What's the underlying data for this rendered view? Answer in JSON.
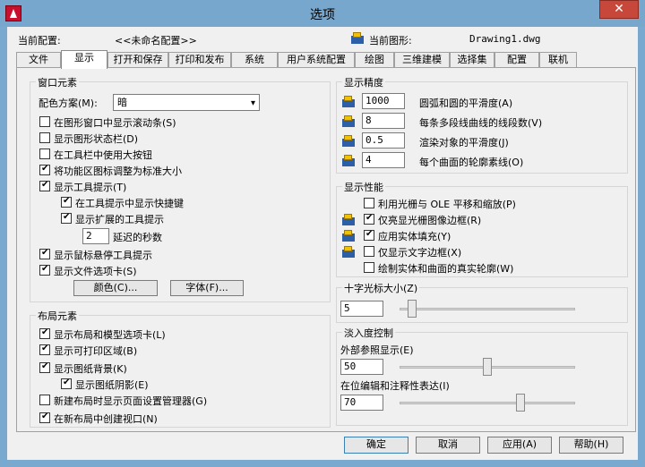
{
  "window": {
    "title": "选项",
    "close": "✕"
  },
  "header": {
    "profile_label": "当前配置:",
    "profile_value": "<<未命名配置>>",
    "drawing_label": "当前图形:",
    "drawing_value": "Drawing1.dwg"
  },
  "tabs": [
    "文件",
    "显示",
    "打开和保存",
    "打印和发布",
    "系统",
    "用户系统配置",
    "绘图",
    "三维建模",
    "选择集",
    "配置",
    "联机"
  ],
  "window_elements": {
    "title": "窗口元素",
    "scheme_label": "配色方案(M):",
    "scheme_value": "暗",
    "options": [
      {
        "label": "在图形窗口中显示滚动条(S)",
        "checked": false
      },
      {
        "label": "显示图形状态栏(D)",
        "checked": false
      },
      {
        "label": "在工具栏中使用大按钮",
        "checked": false
      },
      {
        "label": "将功能区图标调整为标准大小",
        "checked": true
      },
      {
        "label": "显示工具提示(T)",
        "checked": true
      },
      {
        "label": "在工具提示中显示快捷键",
        "checked": true
      },
      {
        "label": "显示扩展的工具提示",
        "checked": true
      },
      {
        "label": "延迟的秒数",
        "value": "2"
      },
      {
        "label": "显示鼠标悬停工具提示",
        "checked": true
      },
      {
        "label": "显示文件选项卡(S)",
        "checked": true
      }
    ],
    "colors_button": "颜色(C)...",
    "fonts_button": "字体(F)..."
  },
  "layout_elements": {
    "title": "布局元素",
    "options": [
      {
        "label": "显示布局和模型选项卡(L)",
        "checked": true
      },
      {
        "label": "显示可打印区域(B)",
        "checked": true
      },
      {
        "label": "显示图纸背景(K)",
        "checked": true
      },
      {
        "label": "显示图纸阴影(E)",
        "checked": true
      },
      {
        "label": "新建布局时显示页面设置管理器(G)",
        "checked": false
      },
      {
        "label": "在新布局中创建视口(N)",
        "checked": true
      }
    ]
  },
  "display_resolution": {
    "title": "显示精度",
    "items": [
      {
        "value": "1000",
        "label": "圆弧和圆的平滑度(A)"
      },
      {
        "value": "8",
        "label": "每条多段线曲线的线段数(V)"
      },
      {
        "value": "0.5",
        "label": "渲染对象的平滑度(J)"
      },
      {
        "value": "4",
        "label": "每个曲面的轮廓素线(O)"
      }
    ]
  },
  "display_performance": {
    "title": "显示性能",
    "options": [
      {
        "label": "利用光栅与 OLE 平移和缩放(P)",
        "checked": false
      },
      {
        "label": "仅亮显光栅图像边框(R)",
        "checked": true
      },
      {
        "label": "应用实体填充(Y)",
        "checked": true
      },
      {
        "label": "仅显示文字边框(X)",
        "checked": false
      },
      {
        "label": "绘制实体和曲面的真实轮廓(W)",
        "checked": false
      }
    ]
  },
  "crosshair": {
    "title": "十字光标大小(Z)",
    "value": "5",
    "slider_fraction": 0.05
  },
  "fade_control": {
    "title": "淡入度控制",
    "xref_label": "外部参照显示(E)",
    "xref_value": "50",
    "xref_fraction": 0.5,
    "inplace_label": "在位编辑和注释性表达(I)",
    "inplace_value": "70",
    "inplace_fraction": 0.7
  },
  "buttons": {
    "ok": "确定",
    "cancel": "取消",
    "apply": "应用(A)",
    "help": "帮助(H)"
  }
}
